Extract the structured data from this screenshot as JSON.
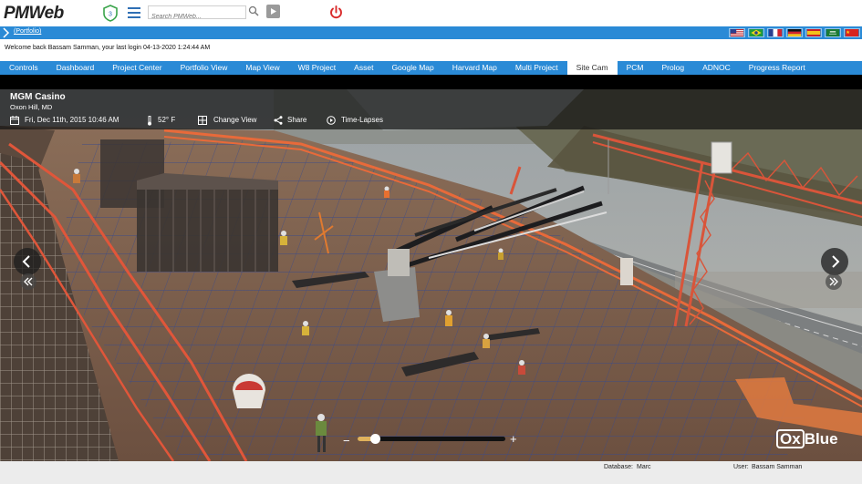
{
  "header": {
    "logo_text": "PMWeb",
    "shield_badge": "3",
    "search_placeholder": "Search PMWeb...",
    "icons": [
      "shield-icon",
      "hamburger-menu-icon",
      "search-icon",
      "video-icon",
      "power-icon"
    ]
  },
  "breadcrumb": {
    "link": "(Portfolio)",
    "flags": [
      "US",
      "BR",
      "FR",
      "DE",
      "ES",
      "SA",
      "CN"
    ]
  },
  "welcome": {
    "text": "Welcome back  Bassam Samman, your last login 04-13-2020 1:24:44 AM"
  },
  "nav": {
    "items": [
      "Controls",
      "Dashboard",
      "Project Center",
      "Portfolio View",
      "Map View",
      "W8 Project",
      "Asset",
      "Google Map",
      "Harvard Map",
      "Multi Project",
      "Site Cam",
      "PCM",
      "Prolog",
      "ADNOC",
      "Progress Report"
    ],
    "active": "Site Cam"
  },
  "camera": {
    "site_name": "MGM Casino",
    "location": "Oxon Hill, MD",
    "datetime": "Fri, Dec 11th, 2015 10:46 AM",
    "temperature": "52° F",
    "change_view_label": "Change View",
    "share_label": "Share",
    "timelapse_label": "Time-Lapses",
    "zoom_minus": "−",
    "zoom_plus": "+",
    "zoom_level": 0.12,
    "brand_ox": "Ox",
    "brand_blue": "Blue"
  },
  "footer": {
    "database_label": "Database:",
    "database_value": "Marc",
    "user_label": "User:",
    "user_value": "Bassam Samman"
  },
  "colors": {
    "accent_blue": "#2a8ad6",
    "slider_fill": "#e0b25c",
    "power_red": "#d92b2b"
  }
}
